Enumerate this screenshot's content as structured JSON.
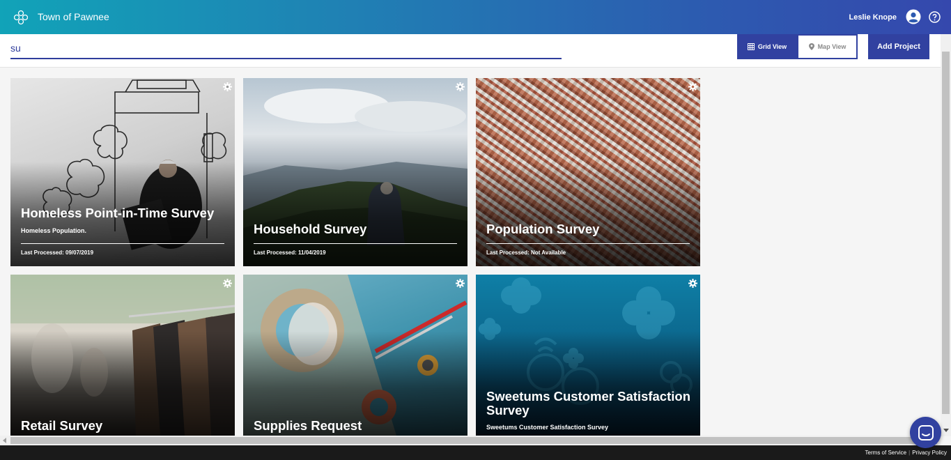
{
  "header": {
    "app_title": "Town of Pawnee",
    "user_name": "Leslie Knope",
    "logo_icon": "clover-icon",
    "avatar_icon": "user-circle-icon",
    "help_icon": "help-circle-icon"
  },
  "search": {
    "value": "su",
    "placeholder": ""
  },
  "toolbar": {
    "grid_view_label": "Grid View",
    "map_view_label": "Map View",
    "add_project_label": "Add Project",
    "active_view": "Grid View"
  },
  "projects": [
    {
      "title": "Homeless Point-in-Time Survey",
      "description": "Homeless Population.",
      "last_processed": "Last Processed: 09/07/2019",
      "image": "man-with-drawn-house"
    },
    {
      "title": "Household Survey",
      "description": "",
      "last_processed": "Last Processed: 11/04/2019",
      "image": "hiker-on-mountain"
    },
    {
      "title": "Population Survey",
      "description": "",
      "last_processed": "Last Processed: Not Available",
      "image": "city-aerial"
    },
    {
      "title": "Retail Survey",
      "description": "",
      "last_processed": "",
      "image": "clothing-rack"
    },
    {
      "title": "Supplies Request",
      "description": "",
      "last_processed": "",
      "image": "tape-and-cutting-tools"
    },
    {
      "title": "Sweetums Customer Satisfaction Survey",
      "description": "Sweetums Customer Satisfaction Survey",
      "last_processed": "",
      "image": "blue-clover-pattern"
    }
  ],
  "footer": {
    "terms_label": "Terms of Service",
    "separator": "|",
    "privacy_label": "Privacy Policy"
  },
  "colors": {
    "brand_primary": "#3141a0",
    "header_gradient_start": "#11a3b8",
    "header_gradient_end": "#3548ad"
  }
}
